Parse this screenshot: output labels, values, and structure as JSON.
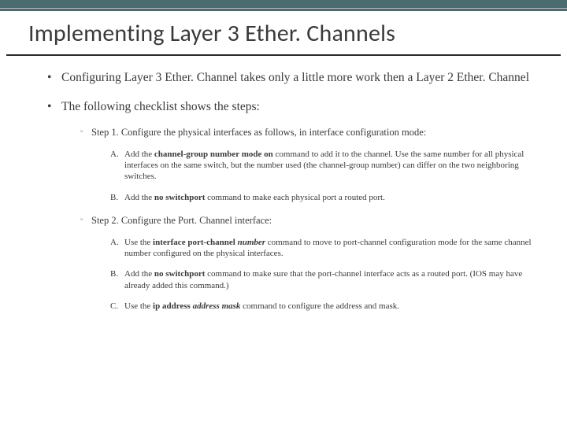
{
  "title": "Implementing Layer 3 Ether. Channels",
  "bullets": {
    "intro1": "Configuring Layer 3 Ether. Channel takes only a little more work then a Layer 2 Ether. Channel",
    "intro2": "The following checklist shows the steps:",
    "step1": "Step 1. Configure the physical interfaces as follows, in interface configuration mode:",
    "step1a_pre": "Add the ",
    "step1a_cmd": "channel-group number mode on",
    "step1a_post": " command to add it to the channel. Use the same number for all physical interfaces on the same switch, but the number used (the channel-group number) can differ on the two neighboring switches.",
    "step1b_pre": "Add the ",
    "step1b_cmd": "no switchport",
    "step1b_post": " command to make each physical port a routed port.",
    "step2": "Step 2. Configure the Port. Channel interface:",
    "step2a_pre": "Use the ",
    "step2a_cmd1": "interface port-channel ",
    "step2a_cmd2": "number",
    "step2a_post": " command to move to port-channel configuration mode for the same channel number configured on the physical interfaces.",
    "step2b_pre": "Add the ",
    "step2b_cmd": "no switchport",
    "step2b_post": " command to make sure that the port-channel interface acts as a routed port. (IOS may have already added this command.)",
    "step2c_pre": "Use the ",
    "step2c_cmd1": "ip address ",
    "step2c_cmd2": "address mask",
    "step2c_post": " command to configure the address and mask."
  },
  "letters": {
    "A": "A.",
    "B": "B.",
    "C": "C."
  }
}
